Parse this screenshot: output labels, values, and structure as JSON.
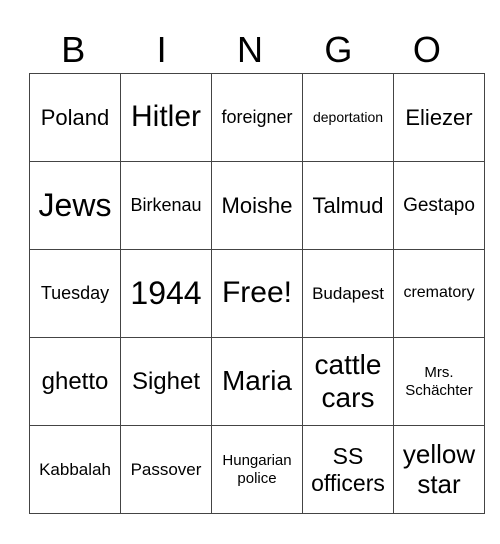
{
  "header": [
    "B",
    "I",
    "N",
    "G",
    "O"
  ],
  "rows": [
    [
      {
        "text": "Poland",
        "size": 22
      },
      {
        "text": "Hitler",
        "size": 30
      },
      {
        "text": "foreigner",
        "size": 18
      },
      {
        "text": "deportation",
        "size": 14
      },
      {
        "text": "Eliezer",
        "size": 22
      }
    ],
    [
      {
        "text": "Jews",
        "size": 32
      },
      {
        "text": "Birkenau",
        "size": 18
      },
      {
        "text": "Moishe",
        "size": 22
      },
      {
        "text": "Talmud",
        "size": 22
      },
      {
        "text": "Gestapo",
        "size": 19
      }
    ],
    [
      {
        "text": "Tuesday",
        "size": 18
      },
      {
        "text": "1944",
        "size": 32
      },
      {
        "text": "Free!",
        "size": 30
      },
      {
        "text": "Budapest",
        "size": 17
      },
      {
        "text": "crematory",
        "size": 16
      }
    ],
    [
      {
        "text": "ghetto",
        "size": 24
      },
      {
        "text": "Sighet",
        "size": 24
      },
      {
        "text": "Maria",
        "size": 28
      },
      {
        "text": "cattle cars",
        "size": 28
      },
      {
        "text": "Mrs. Schächter",
        "size": 15
      }
    ],
    [
      {
        "text": "Kabbalah",
        "size": 17
      },
      {
        "text": "Passover",
        "size": 17
      },
      {
        "text": "Hungarian police",
        "size": 15
      },
      {
        "text": "SS officers",
        "size": 23
      },
      {
        "text": "yellow star",
        "size": 26
      }
    ]
  ]
}
